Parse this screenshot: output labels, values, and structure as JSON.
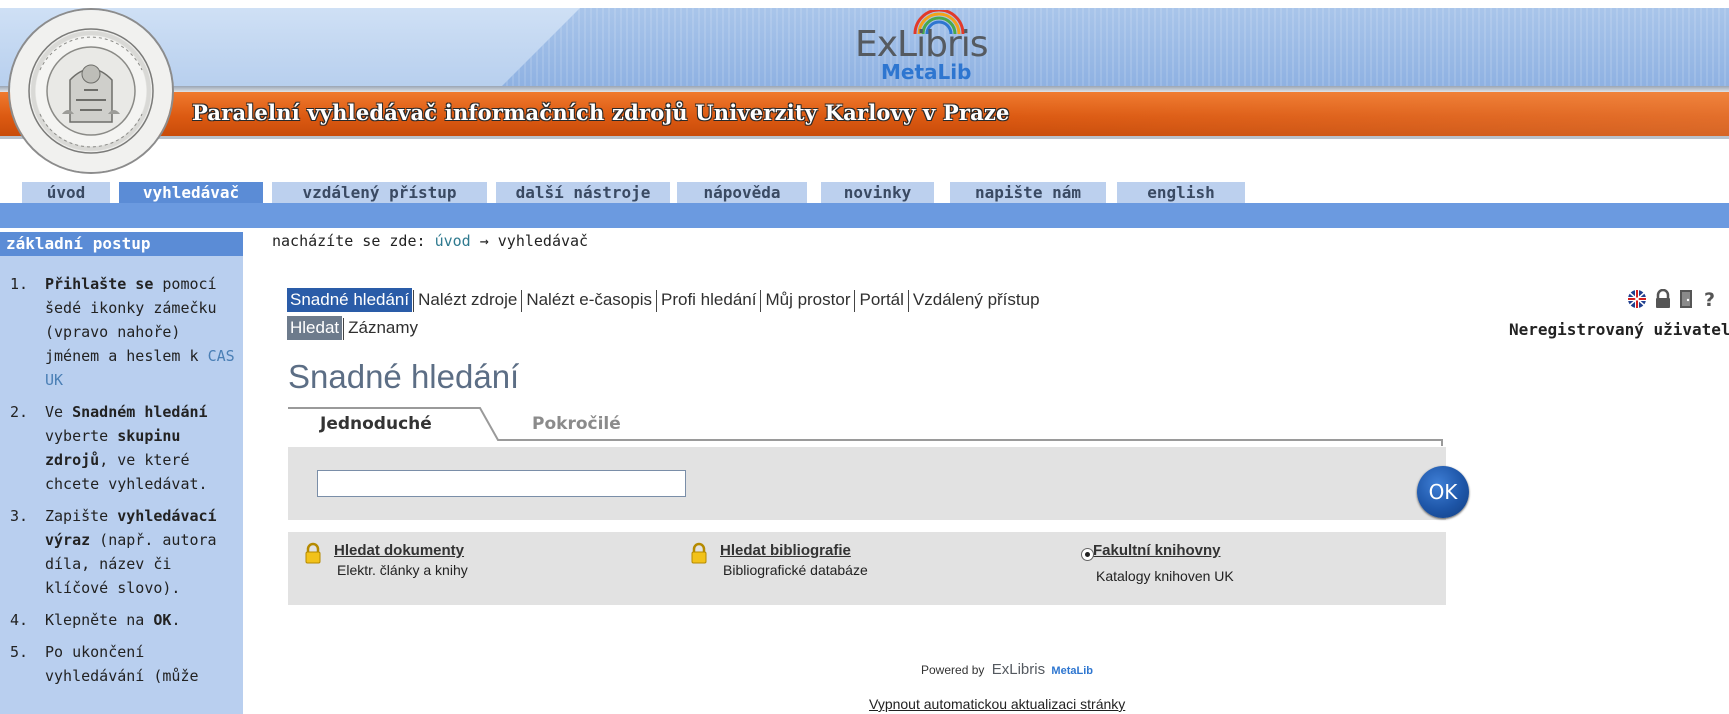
{
  "banner": {
    "title": "Paralelní vyhledávač informačních zdrojů Univerzity Karlovy v Praze",
    "logo_brand": "ExLibris",
    "logo_product": "MetaLib"
  },
  "tabs": [
    {
      "label": "úvod",
      "active": false
    },
    {
      "label": "vyhledávač",
      "active": true
    },
    {
      "label": "vzdálený přístup",
      "active": false
    },
    {
      "label": "další nástroje",
      "active": false
    },
    {
      "label": "nápověda",
      "active": false
    },
    {
      "label": "novinky",
      "active": false
    },
    {
      "label": "napište nám",
      "active": false
    },
    {
      "label": "english",
      "active": false
    }
  ],
  "sidebar": {
    "heading": "základní postup",
    "steps": [
      {
        "num": "1.",
        "html_parts": [
          [
            "b",
            "Přihlašte se"
          ],
          [
            "t",
            " pomocí šedé ikonky zámečku (vpravo nahoře) jménem a heslem k "
          ],
          [
            "a",
            "CAS UK"
          ]
        ]
      },
      {
        "num": "2.",
        "html_parts": [
          [
            "t",
            "Ve "
          ],
          [
            "b",
            "Snadném hledání"
          ],
          [
            "t",
            " vyberte "
          ],
          [
            "b",
            "skupinu zdrojů"
          ],
          [
            "t",
            ", ve které chcete vyhledávat."
          ]
        ]
      },
      {
        "num": "3.",
        "html_parts": [
          [
            "t",
            "Zapište "
          ],
          [
            "b",
            "vyhledávací výraz"
          ],
          [
            "t",
            " (např. autora díla, název či klíčové slovo)."
          ]
        ]
      },
      {
        "num": "4.",
        "html_parts": [
          [
            "t",
            "Klepněte na "
          ],
          [
            "b",
            "OK"
          ],
          [
            "t",
            "."
          ]
        ]
      },
      {
        "num": "5.",
        "html_parts": [
          [
            "t",
            "Po ukončení vyhledávání (může"
          ]
        ]
      }
    ]
  },
  "breadcrumb": {
    "prefix": "nacházíte se zde:",
    "link": "úvod",
    "arrow": "→",
    "current": "vyhledávač"
  },
  "user": {
    "status": "Neregistrovaný uživatel",
    "icons": [
      "english-flag-icon",
      "lock-icon",
      "logout-door-icon",
      "help-icon"
    ]
  },
  "metalib_nav": {
    "main": [
      "Snadné hledání",
      "Nalézt zdroje",
      "Nalézt e-časopis",
      "Profi hledání",
      "Můj prostor",
      "Portál",
      "Vzdálený přístup"
    ],
    "main_active": 0,
    "sub": [
      "Hledat",
      "Záznamy"
    ],
    "sub_active": 0
  },
  "page_title": "Snadné hledání",
  "search": {
    "tab_simple": "Jednoduché",
    "tab_advanced": "Pokročilé",
    "input_value": "",
    "ok_label": "OK"
  },
  "groups": [
    {
      "title": "Hledat dokumenty",
      "desc": "Elektr. články a knihy",
      "control": "lock"
    },
    {
      "title": "Hledat bibliografie",
      "desc": "Bibliografické databáze",
      "control": "lock"
    },
    {
      "title": "Fakultní knihovny",
      "desc": "Katalogy knihoven UK",
      "control": "radio",
      "selected": true
    }
  ],
  "footer": {
    "powered_by": "Powered by",
    "brand": "ExLibris",
    "product": "MetaLib",
    "auto_refresh_link": "Vypnout automatickou aktualizaci stránky"
  },
  "colors": {
    "accent_blue": "#5b8cd6",
    "banner_orange": "#dc5a12",
    "nav_active": "#2a5ca8"
  }
}
